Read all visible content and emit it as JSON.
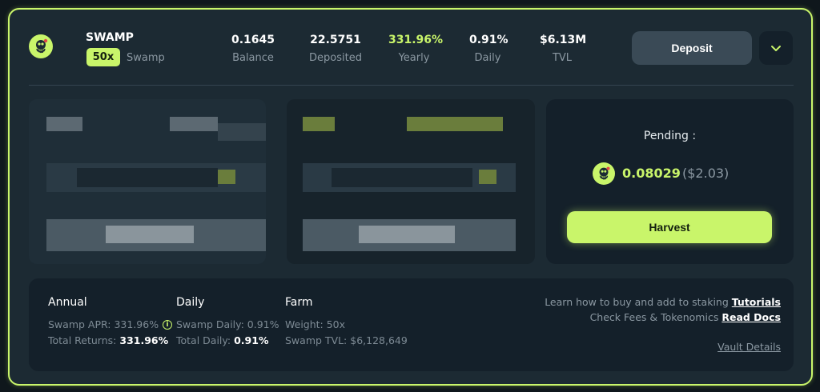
{
  "pool": {
    "name": "SWAMP",
    "multiplier": "50x",
    "subtitle": "Swamp",
    "logo_icon": "swamp-octopus-icon"
  },
  "stats": [
    {
      "value": "0.1645",
      "label": "Balance",
      "highlight": false
    },
    {
      "value": "22.5751",
      "label": "Deposited",
      "highlight": false
    },
    {
      "value": "331.96%",
      "label": "Yearly",
      "highlight": true
    },
    {
      "value": "0.91%",
      "label": "Daily",
      "highlight": false
    },
    {
      "value": "$6.13M",
      "label": "TVL",
      "highlight": false
    }
  ],
  "actions": {
    "deposit_label": "Deposit",
    "expand_icon": "chevron-down-icon"
  },
  "pending": {
    "title": "Pending :",
    "amount": "0.08029",
    "usd": "($2.03)",
    "harvest_label": "Harvest"
  },
  "info": {
    "annual": {
      "title": "Annual",
      "apr_label": "Swamp APR: 331.96%",
      "total_label": "Total Returns:",
      "total_value": "331.96%"
    },
    "daily": {
      "title": "Daily",
      "swamp_label": "Swamp Daily: 0.91%",
      "total_label": "Total Daily:",
      "total_value": "0.91%"
    },
    "farm": {
      "title": "Farm",
      "weight": "Weight: 50x",
      "tvl": "Swamp TVL: $6,128,649"
    },
    "links": {
      "learn_text": "Learn how to buy and add to staking",
      "tutorials": "Tutorials",
      "fees_text": "Check Fees & Tokenomics",
      "docs": "Read Docs",
      "vault_details": "Vault Details"
    }
  },
  "colors": {
    "accent": "#c9f56a",
    "card_bg": "#1c2a33",
    "panel_bg": "#14202a",
    "muted": "#8b98a2"
  }
}
